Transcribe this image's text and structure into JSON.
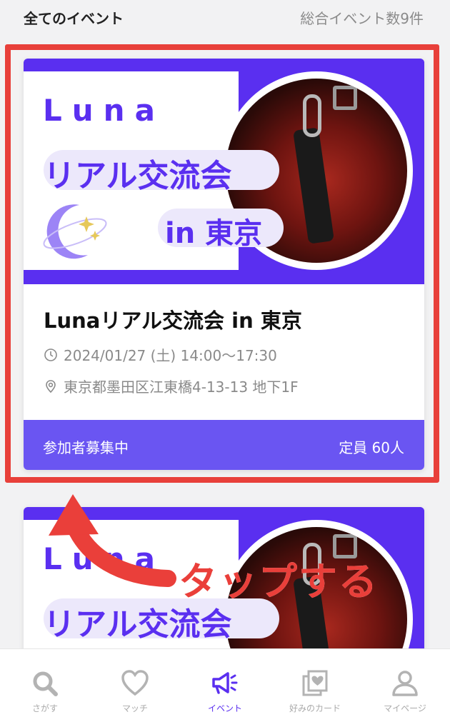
{
  "header": {
    "title": "全てのイベント",
    "total": "総合イベント数9件"
  },
  "events": [
    {
      "banner": {
        "brand": "Luna",
        "line1": "リアル交流会",
        "line2": "in 東京"
      },
      "title": "Lunaリアル交流会 in 東京",
      "datetime": "2024/01/27 (土) 14:00〜17:30",
      "place": "東京都墨田区江東橋4-13-13 地下1F",
      "status": "参加者募集中",
      "capacity": "定員 60人"
    },
    {
      "banner": {
        "brand": "Luna",
        "line1": "リアル交流会"
      }
    }
  ],
  "annotation": {
    "text": "タップする",
    "color": "#ea3f3a"
  },
  "tabs": [
    {
      "label": "さがす",
      "icon": "search-icon"
    },
    {
      "label": "マッチ",
      "icon": "heart-icon"
    },
    {
      "label": "イベント",
      "icon": "megaphone-icon",
      "active": true
    },
    {
      "label": "好みのカード",
      "icon": "heart-card-icon"
    },
    {
      "label": "マイページ",
      "icon": "person-icon"
    }
  ],
  "colors": {
    "accent": "#5a2ff0",
    "footer": "#6a55f2",
    "highlight": "#e8403a"
  }
}
